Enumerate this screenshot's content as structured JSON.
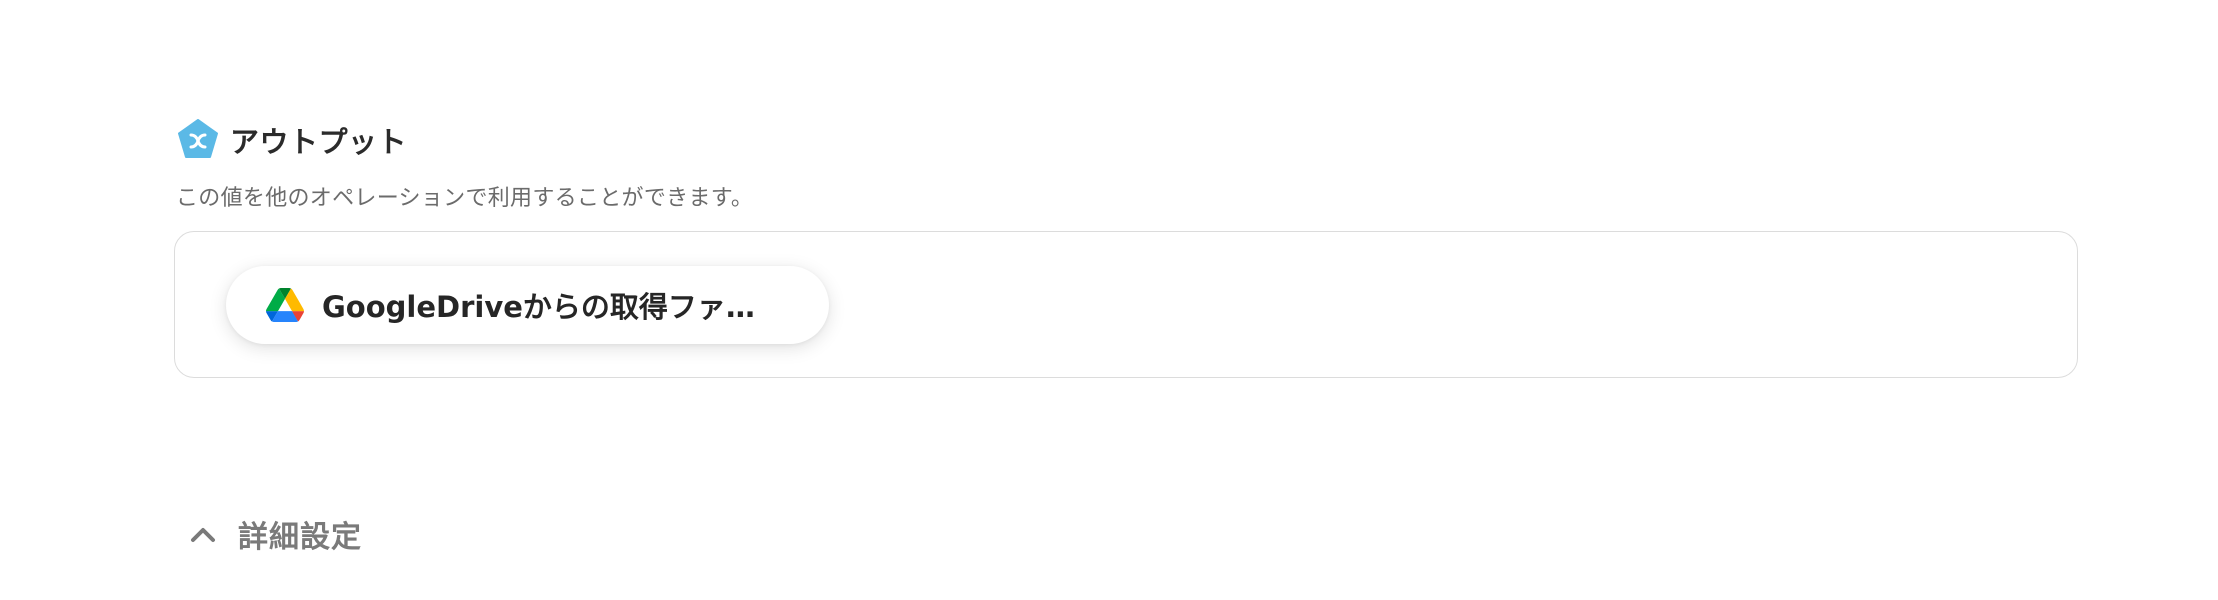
{
  "output": {
    "icon": "yoom-pentagon-icon",
    "icon_color": "#5bb9e6",
    "title": "アウトプット",
    "description": "この値を他のオペレーションで利用することができます。",
    "chips": [
      {
        "icon": "google-drive-icon",
        "label": "GoogleDriveからの取得ファ…"
      }
    ]
  },
  "advanced_settings": {
    "icon": "chevron-up-icon",
    "label": "詳細設定"
  }
}
